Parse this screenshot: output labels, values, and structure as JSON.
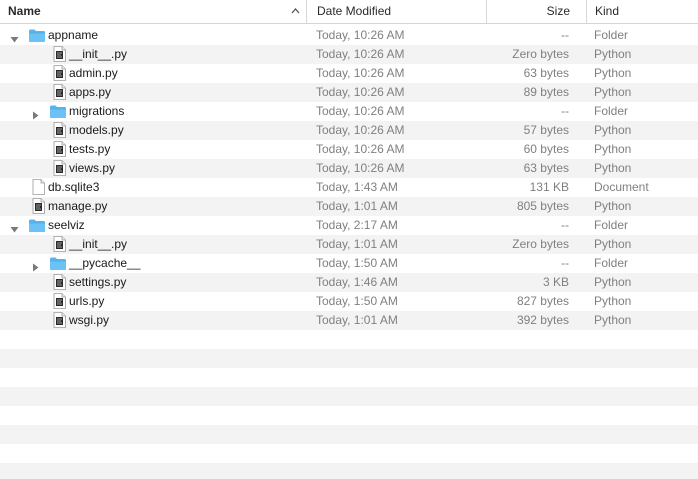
{
  "header": {
    "name": "Name",
    "date_modified": "Date Modified",
    "size": "Size",
    "kind": "Kind"
  },
  "colors": {
    "folder_icon": "#5ab4ee",
    "alt_row": "#f3f3f3",
    "muted_text": "#808080"
  },
  "rows": [
    {
      "name": "appname",
      "date": "Today, 10:26 AM",
      "size": "--",
      "kind": "Folder",
      "icon": "folder-icon",
      "disclosure": "expanded",
      "level": 0
    },
    {
      "name": "__init__.py",
      "date": "Today, 10:26 AM",
      "size": "Zero bytes",
      "kind": "Python",
      "icon": "python-file-icon",
      "disclosure": "none",
      "level": 1
    },
    {
      "name": "admin.py",
      "date": "Today, 10:26 AM",
      "size": "63 bytes",
      "kind": "Python",
      "icon": "python-file-icon",
      "disclosure": "none",
      "level": 1
    },
    {
      "name": "apps.py",
      "date": "Today, 10:26 AM",
      "size": "89 bytes",
      "kind": "Python",
      "icon": "python-file-icon",
      "disclosure": "none",
      "level": 1
    },
    {
      "name": "migrations",
      "date": "Today, 10:26 AM",
      "size": "--",
      "kind": "Folder",
      "icon": "folder-icon",
      "disclosure": "collapsed",
      "level": 1
    },
    {
      "name": "models.py",
      "date": "Today, 10:26 AM",
      "size": "57 bytes",
      "kind": "Python",
      "icon": "python-file-icon",
      "disclosure": "none",
      "level": 1
    },
    {
      "name": "tests.py",
      "date": "Today, 10:26 AM",
      "size": "60 bytes",
      "kind": "Python",
      "icon": "python-file-icon",
      "disclosure": "none",
      "level": 1
    },
    {
      "name": "views.py",
      "date": "Today, 10:26 AM",
      "size": "63 bytes",
      "kind": "Python",
      "icon": "python-file-icon",
      "disclosure": "none",
      "level": 1
    },
    {
      "name": "db.sqlite3",
      "date": "Today, 1:43 AM",
      "size": "131 KB",
      "kind": "Document",
      "icon": "document-icon",
      "disclosure": "none",
      "level": 0
    },
    {
      "name": "manage.py",
      "date": "Today, 1:01 AM",
      "size": "805 bytes",
      "kind": "Python",
      "icon": "python-file-icon",
      "disclosure": "none",
      "level": 0
    },
    {
      "name": "seelviz",
      "date": "Today, 2:17 AM",
      "size": "--",
      "kind": "Folder",
      "icon": "folder-icon",
      "disclosure": "expanded",
      "level": 0
    },
    {
      "name": "__init__.py",
      "date": "Today, 1:01 AM",
      "size": "Zero bytes",
      "kind": "Python",
      "icon": "python-file-icon",
      "disclosure": "none",
      "level": 1
    },
    {
      "name": "__pycache__",
      "date": "Today, 1:50 AM",
      "size": "--",
      "kind": "Folder",
      "icon": "folder-icon",
      "disclosure": "collapsed",
      "level": 1
    },
    {
      "name": "settings.py",
      "date": "Today, 1:46 AM",
      "size": "3 KB",
      "kind": "Python",
      "icon": "python-file-icon",
      "disclosure": "none",
      "level": 1
    },
    {
      "name": "urls.py",
      "date": "Today, 1:50 AM",
      "size": "827 bytes",
      "kind": "Python",
      "icon": "python-file-icon",
      "disclosure": "none",
      "level": 1
    },
    {
      "name": "wsgi.py",
      "date": "Today, 1:01 AM",
      "size": "392 bytes",
      "kind": "Python",
      "icon": "python-file-icon",
      "disclosure": "none",
      "level": 1
    }
  ]
}
